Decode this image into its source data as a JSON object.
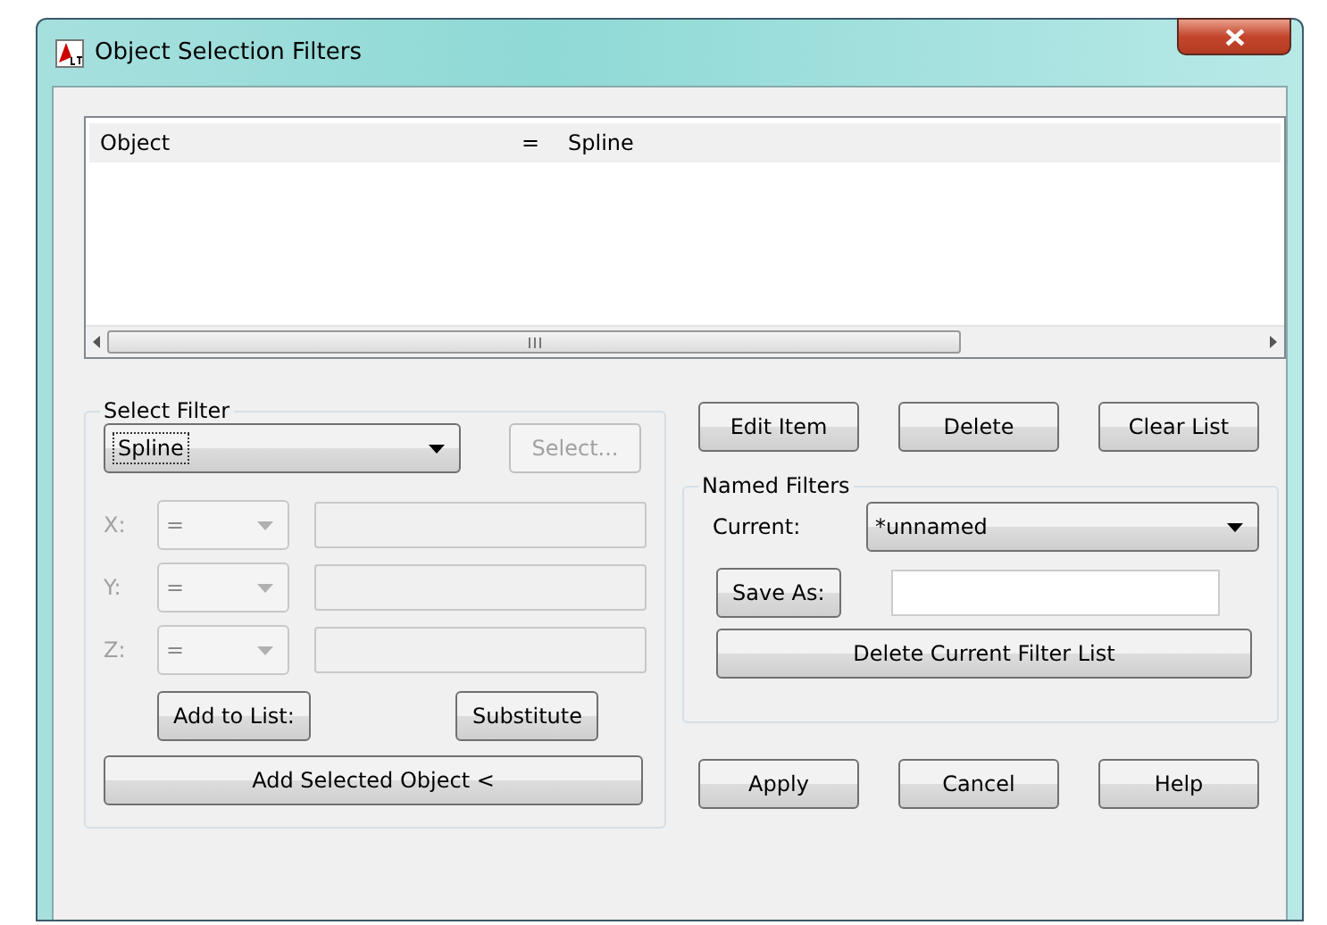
{
  "window": {
    "title": "Object Selection Filters"
  },
  "filter_list": {
    "rows": [
      {
        "column_1": "Object",
        "column_2": "=",
        "column_3": "Spline",
        "selected": true
      }
    ]
  },
  "select_filter": {
    "title": "Select Filter",
    "type_dropdown": {
      "value": "Spline"
    },
    "select_button": {
      "label": "Select...",
      "disabled": true
    },
    "coordinates": [
      {
        "label": "X:",
        "operator": "=",
        "disabled": true
      },
      {
        "label": "Y:",
        "operator": "=",
        "disabled": true
      },
      {
        "label": "Z:",
        "operator": "=",
        "disabled": true
      }
    ],
    "add_to_list_button": "Add to List:",
    "substitute_button": "Substitute",
    "add_selected_button": "Add Selected Object <"
  },
  "list_buttons": [
    "Edit Item",
    "Delete",
    "Clear List"
  ],
  "named_filters": {
    "title": "Named Filters",
    "current_label": "Current:",
    "current_value": "*unnamed",
    "save_as_button": "Save As:",
    "delete_button": "Delete Current Filter List"
  },
  "dialog_buttons": [
    "Apply",
    "Cancel",
    "Help"
  ]
}
